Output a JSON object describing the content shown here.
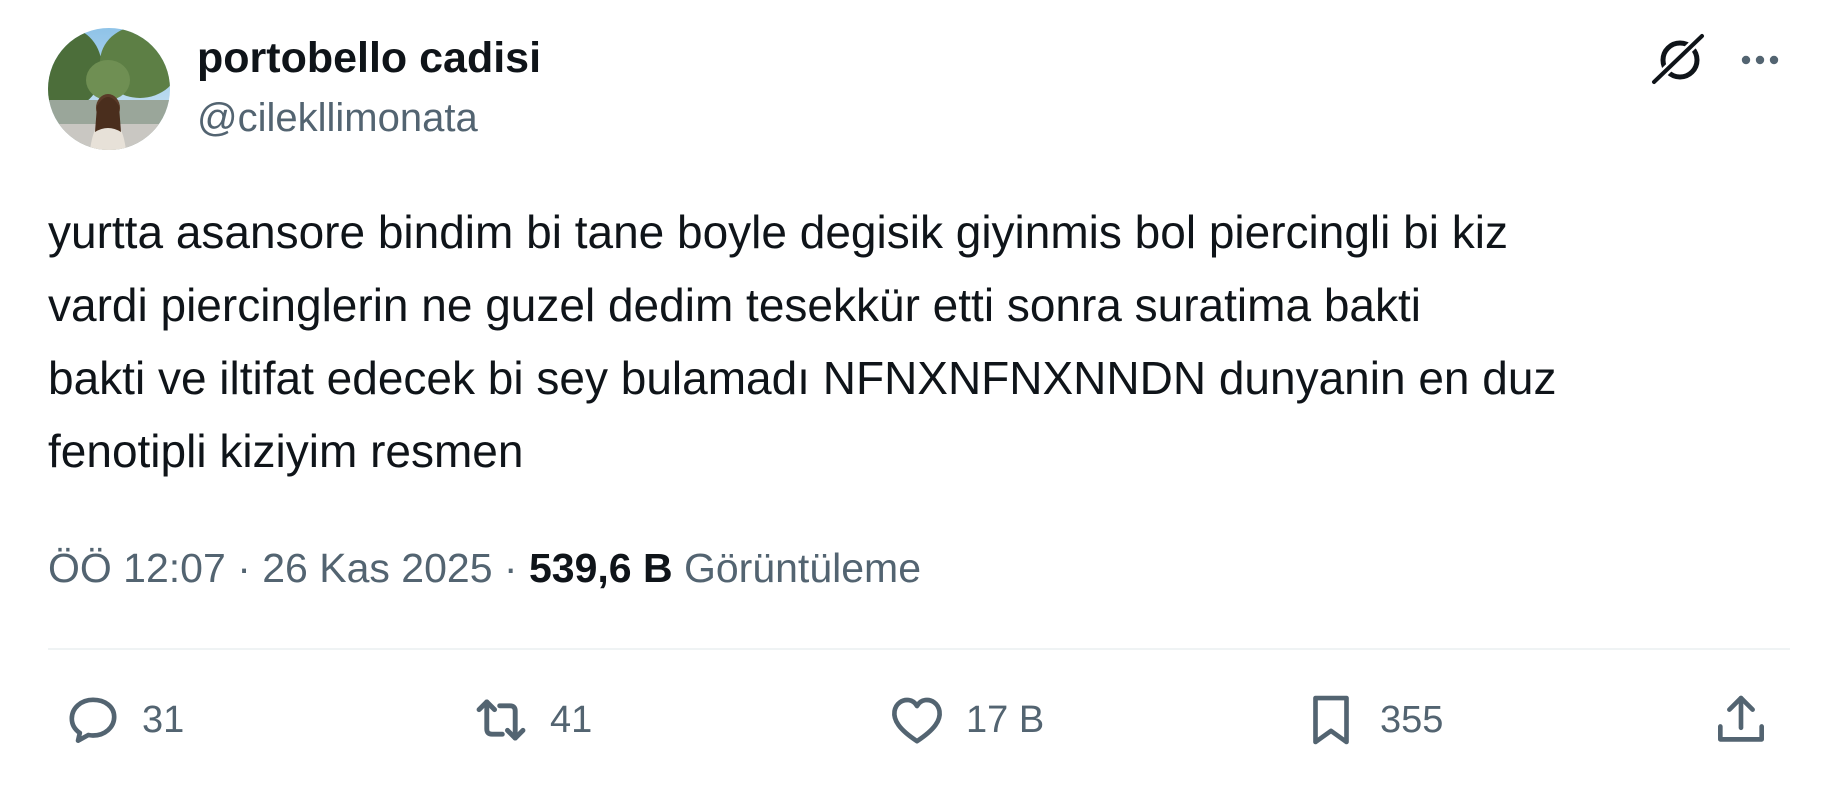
{
  "author": {
    "name": "portobello cadisi",
    "handle": "@cilekllimonata",
    "avatar_icon": "profile-photo"
  },
  "tweet": {
    "text": "yurtta asansore bindim bi tane boyle degisik giyinmis bol piercingli bi kiz\nvardi piercinglerin ne guzel dedim tesekkür etti sonra suratima bakti\nbakti ve iltifat edecek bi sey bulamadı NFNXNFNXNNDN dunyanin en duz\nfenotipli kiziyim resmen",
    "time": "ÖÖ 12:07",
    "date": "26 Kas 2025",
    "separator": "·",
    "views_count": "539,6 B",
    "views_label": "Görüntüleme"
  },
  "header_icons": {
    "grok": "grok-icon",
    "more": "more-icon"
  },
  "actions": {
    "reply_count": "31",
    "retweet_count": "41",
    "like_count": "17 B",
    "bookmark_count": "355"
  },
  "colors": {
    "text_primary": "#0f1419",
    "text_secondary": "#536471",
    "divider": "#eff3f4",
    "background": "#ffffff"
  }
}
